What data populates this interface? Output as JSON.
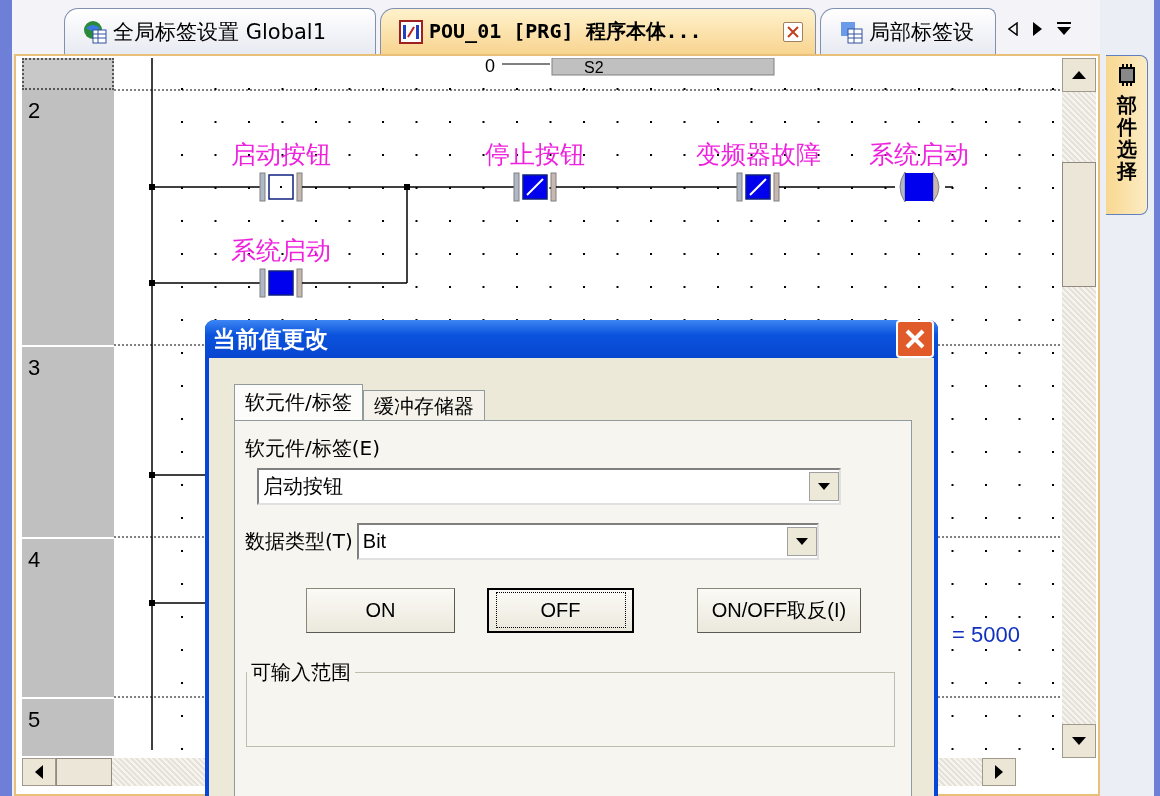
{
  "tabs": [
    {
      "label": "全局标签设置 Global1",
      "selected": false,
      "closable": false
    },
    {
      "label": "POU_01 [PRG] 程序本体...",
      "selected": true,
      "closable": true
    },
    {
      "label": "局部标签设",
      "selected": false,
      "closable": false
    }
  ],
  "side_panel": {
    "title": "部件选择"
  },
  "editor": {
    "rows": [
      {
        "number": "2"
      },
      {
        "number": "3"
      },
      {
        "number": "4"
      },
      {
        "number": "5"
      }
    ],
    "top_fragment": {
      "value": "0",
      "device": "S2"
    },
    "rung": [
      {
        "kind": "contact_no",
        "label": "启动按钮",
        "on": false
      },
      {
        "kind": "contact_nc",
        "label": "停止按钮",
        "on": true
      },
      {
        "kind": "contact_nc",
        "label": "变频器故障",
        "on": true
      },
      {
        "kind": "coil",
        "label": "系统启动",
        "on": true
      }
    ],
    "branch": [
      {
        "kind": "contact_no",
        "label": "系统启动",
        "on": true
      }
    ],
    "comparison": "= 5000"
  },
  "dialog": {
    "title": "当前值更改",
    "tabs": [
      {
        "label": "软元件/标签",
        "selected": true
      },
      {
        "label": "缓冲存储器",
        "selected": false
      }
    ],
    "device_label": "软元件/标签(E)",
    "device_value": "启动按钮",
    "type_label": "数据类型(T)",
    "type_value": "Bit",
    "buttons": [
      {
        "label": "ON",
        "default": false
      },
      {
        "label": "OFF",
        "default": true
      },
      {
        "label": "ON/OFF取反(I)",
        "default": false
      }
    ],
    "range_group": "可输入范围"
  }
}
